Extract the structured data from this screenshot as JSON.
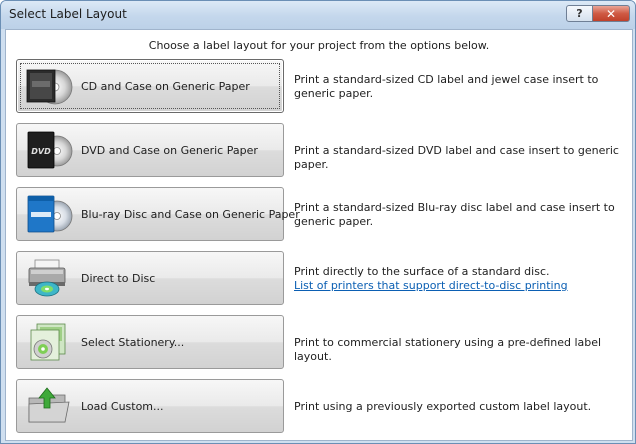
{
  "window": {
    "title": "Select Label Layout",
    "help_label": "?",
    "close_label": "✕"
  },
  "instruction": "Choose a label layout for your project from the options below.",
  "options": [
    {
      "label": "CD and Case on Generic Paper",
      "description": "Print a standard-sized CD label and jewel case insert to generic paper.",
      "icon": "cd-case-icon"
    },
    {
      "label": "DVD and Case on Generic Paper",
      "description": "Print a standard-sized DVD label and case insert to generic paper.",
      "icon": "dvd-case-icon",
      "icon_text": "DVD"
    },
    {
      "label": "Blu-ray Disc and Case on Generic Paper",
      "description": "Print a standard-sized Blu-ray disc label and case insert to generic paper.",
      "icon": "bluray-case-icon"
    },
    {
      "label": "Direct to Disc",
      "description": "Print directly to the surface of a standard disc.",
      "link": "List of printers that support direct-to-disc printing",
      "icon": "printer-disc-icon"
    },
    {
      "label": "Select Stationery...",
      "description": "Print to commercial stationery using a pre-defined label layout.",
      "icon": "stationery-icon"
    },
    {
      "label": "Load Custom...",
      "description": "Print using a previously exported custom label layout.",
      "icon": "folder-load-icon"
    }
  ],
  "colors": {
    "link": "#0b5fb3",
    "close_button": "#c0402a",
    "titlebar": "#c4d7ec"
  }
}
